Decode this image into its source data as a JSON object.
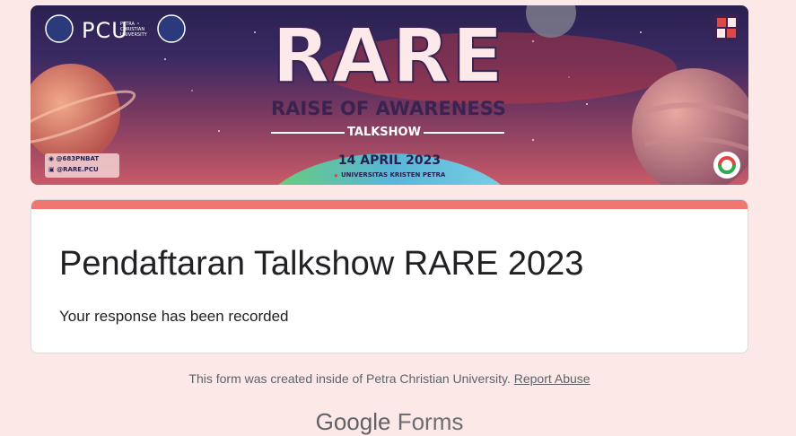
{
  "banner": {
    "event_title": "RARE",
    "event_subtitle": "RAISE OF AWARENESS",
    "event_type": "TALKSHOW",
    "event_date": "14 APRIL 2023",
    "event_location": "UNIVERSITAS KRISTEN PETRA",
    "social_handle_1": "@683PNBAT",
    "social_handle_2": "@RARE.PCU",
    "logo_pcu": "PCU",
    "logo_pcu_caption": "PETRA CHRISTIAN UNIVERSITY",
    "colors": {
      "title_fill": "#fde8ea",
      "title_outline": "#3a2350",
      "accent_red": "#e04848"
    }
  },
  "card": {
    "title": "Pendaftaran Talkshow RARE 2023",
    "message": "Your response has been recorded",
    "accent_color": "#f07672"
  },
  "footer": {
    "note": "This form was created inside of Petra Christian University.",
    "report_link": "Report Abuse",
    "brand_google": "Google",
    "brand_forms": "Forms"
  }
}
